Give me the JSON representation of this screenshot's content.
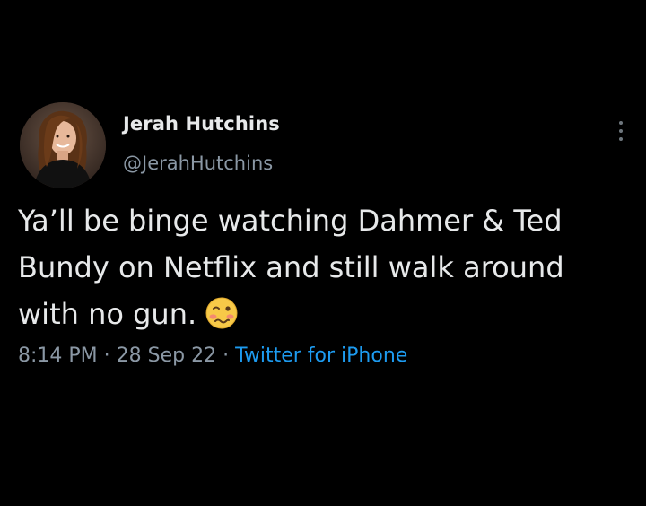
{
  "tweet": {
    "author": {
      "display_name": "Jerah Hutchins",
      "handle": "@JerahHutchins",
      "avatar_icon": "profile-photo"
    },
    "text": "Ya’ll be binge watching Dahmer & Ted\nBundy on Netflix and still walk around\nwith no gun.",
    "emoji": "woozy-face",
    "time": "8:14 PM",
    "separator": " · ",
    "date": "28 Sep 22",
    "source": "Twitter for iPhone",
    "more_icon": "more-options-icon"
  },
  "colors": {
    "background": "#000000",
    "primary_text": "#e7e9ea",
    "secondary_text": "#8b98a5",
    "link": "#1d9bf0"
  }
}
